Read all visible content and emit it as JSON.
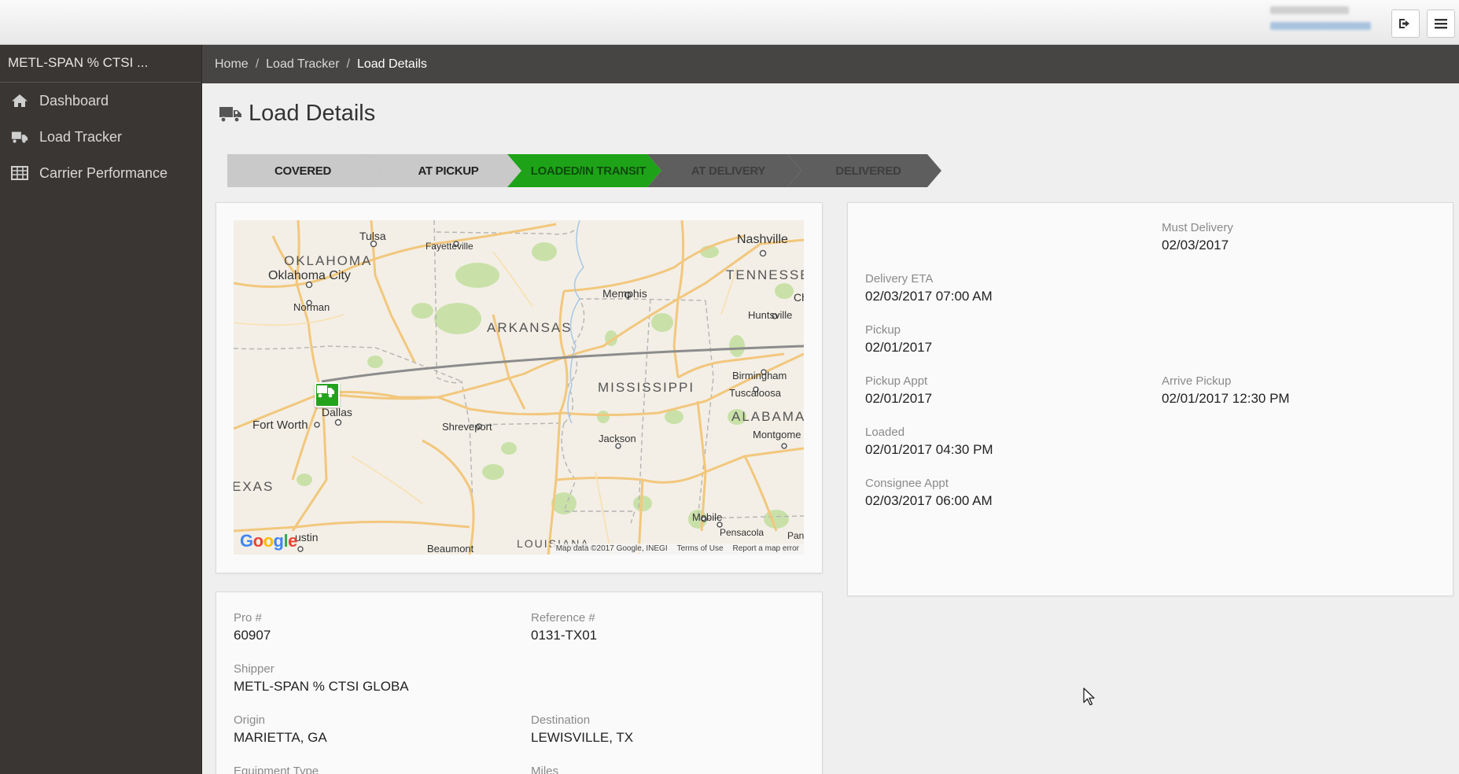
{
  "header": {
    "logout_icon": "logout-icon",
    "menu_icon": "hamburger-icon"
  },
  "sidebar": {
    "title": "METL-SPAN % CTSI ...",
    "items": [
      {
        "label": "Dashboard",
        "icon": "home-icon"
      },
      {
        "label": "Load Tracker",
        "icon": "truck-icon"
      },
      {
        "label": "Carrier Performance",
        "icon": "table-icon"
      }
    ]
  },
  "breadcrumb": {
    "home": "Home",
    "load_tracker": "Load Tracker",
    "current": "Load Details",
    "separator": "/"
  },
  "page": {
    "title": "Load Details",
    "title_icon": "truck-icon"
  },
  "status_steps": {
    "steps": [
      {
        "label": "COVERED",
        "state": "done"
      },
      {
        "label": "AT PICKUP",
        "state": "done"
      },
      {
        "label": "LOADED/IN TRANSIT",
        "state": "active"
      },
      {
        "label": "AT DELIVERY",
        "state": "pending"
      },
      {
        "label": "DELIVERED",
        "state": "pending"
      }
    ],
    "colors": {
      "done": "#c9c9c9",
      "active": "#1ea318",
      "pending": "#5e5e5e"
    }
  },
  "map": {
    "states": [
      "OKLAHOMA",
      "ARKANSAS",
      "TENNESSEE",
      "MISSISSIPPI",
      "ALABAMA",
      "EXAS",
      "LOUISIANA"
    ],
    "cities": [
      "Tulsa",
      "Fayetteville",
      "Nashville",
      "Oklahoma City",
      "Norman",
      "Memphis",
      "Huntsville",
      "Ch",
      "Birmingham",
      "Tuscaloosa",
      "Dallas",
      "Fort Worth",
      "Shreveport",
      "Jackson",
      "Montgome",
      "Mobile",
      "Pensacola",
      "Pan",
      "ustin",
      "Beaumont"
    ],
    "google": "Google",
    "footer": {
      "attribution": "Map data ©2017 Google, INEGI",
      "terms": "Terms of Use",
      "report": "Report a map error"
    },
    "marker_icon": "truck-icon"
  },
  "schedule": {
    "must_delivery": {
      "label": "Must Delivery",
      "value": "02/03/2017"
    },
    "delivery_eta": {
      "label": "Delivery ETA",
      "value": "02/03/2017 07:00 AM"
    },
    "pickup": {
      "label": "Pickup",
      "value": "02/01/2017"
    },
    "pickup_appt": {
      "label": "Pickup Appt",
      "value": "02/01/2017"
    },
    "arrive_pickup": {
      "label": "Arrive Pickup",
      "value": "02/01/2017 12:30 PM"
    },
    "loaded": {
      "label": "Loaded",
      "value": "02/01/2017 04:30 PM"
    },
    "consignee_appt": {
      "label": "Consignee Appt",
      "value": "02/03/2017 06:00 AM"
    }
  },
  "details": {
    "pro": {
      "label": "Pro #",
      "value": "60907"
    },
    "reference": {
      "label": "Reference #",
      "value": "0131-TX01"
    },
    "shipper": {
      "label": "Shipper",
      "value": "METL-SPAN % CTSI GLOBA"
    },
    "origin": {
      "label": "Origin",
      "value": "MARIETTA, GA"
    },
    "destination": {
      "label": "Destination",
      "value": "LEWISVILLE, TX"
    },
    "equipment_type": {
      "label": "Equipment Type"
    },
    "miles": {
      "label": "Miles"
    }
  }
}
